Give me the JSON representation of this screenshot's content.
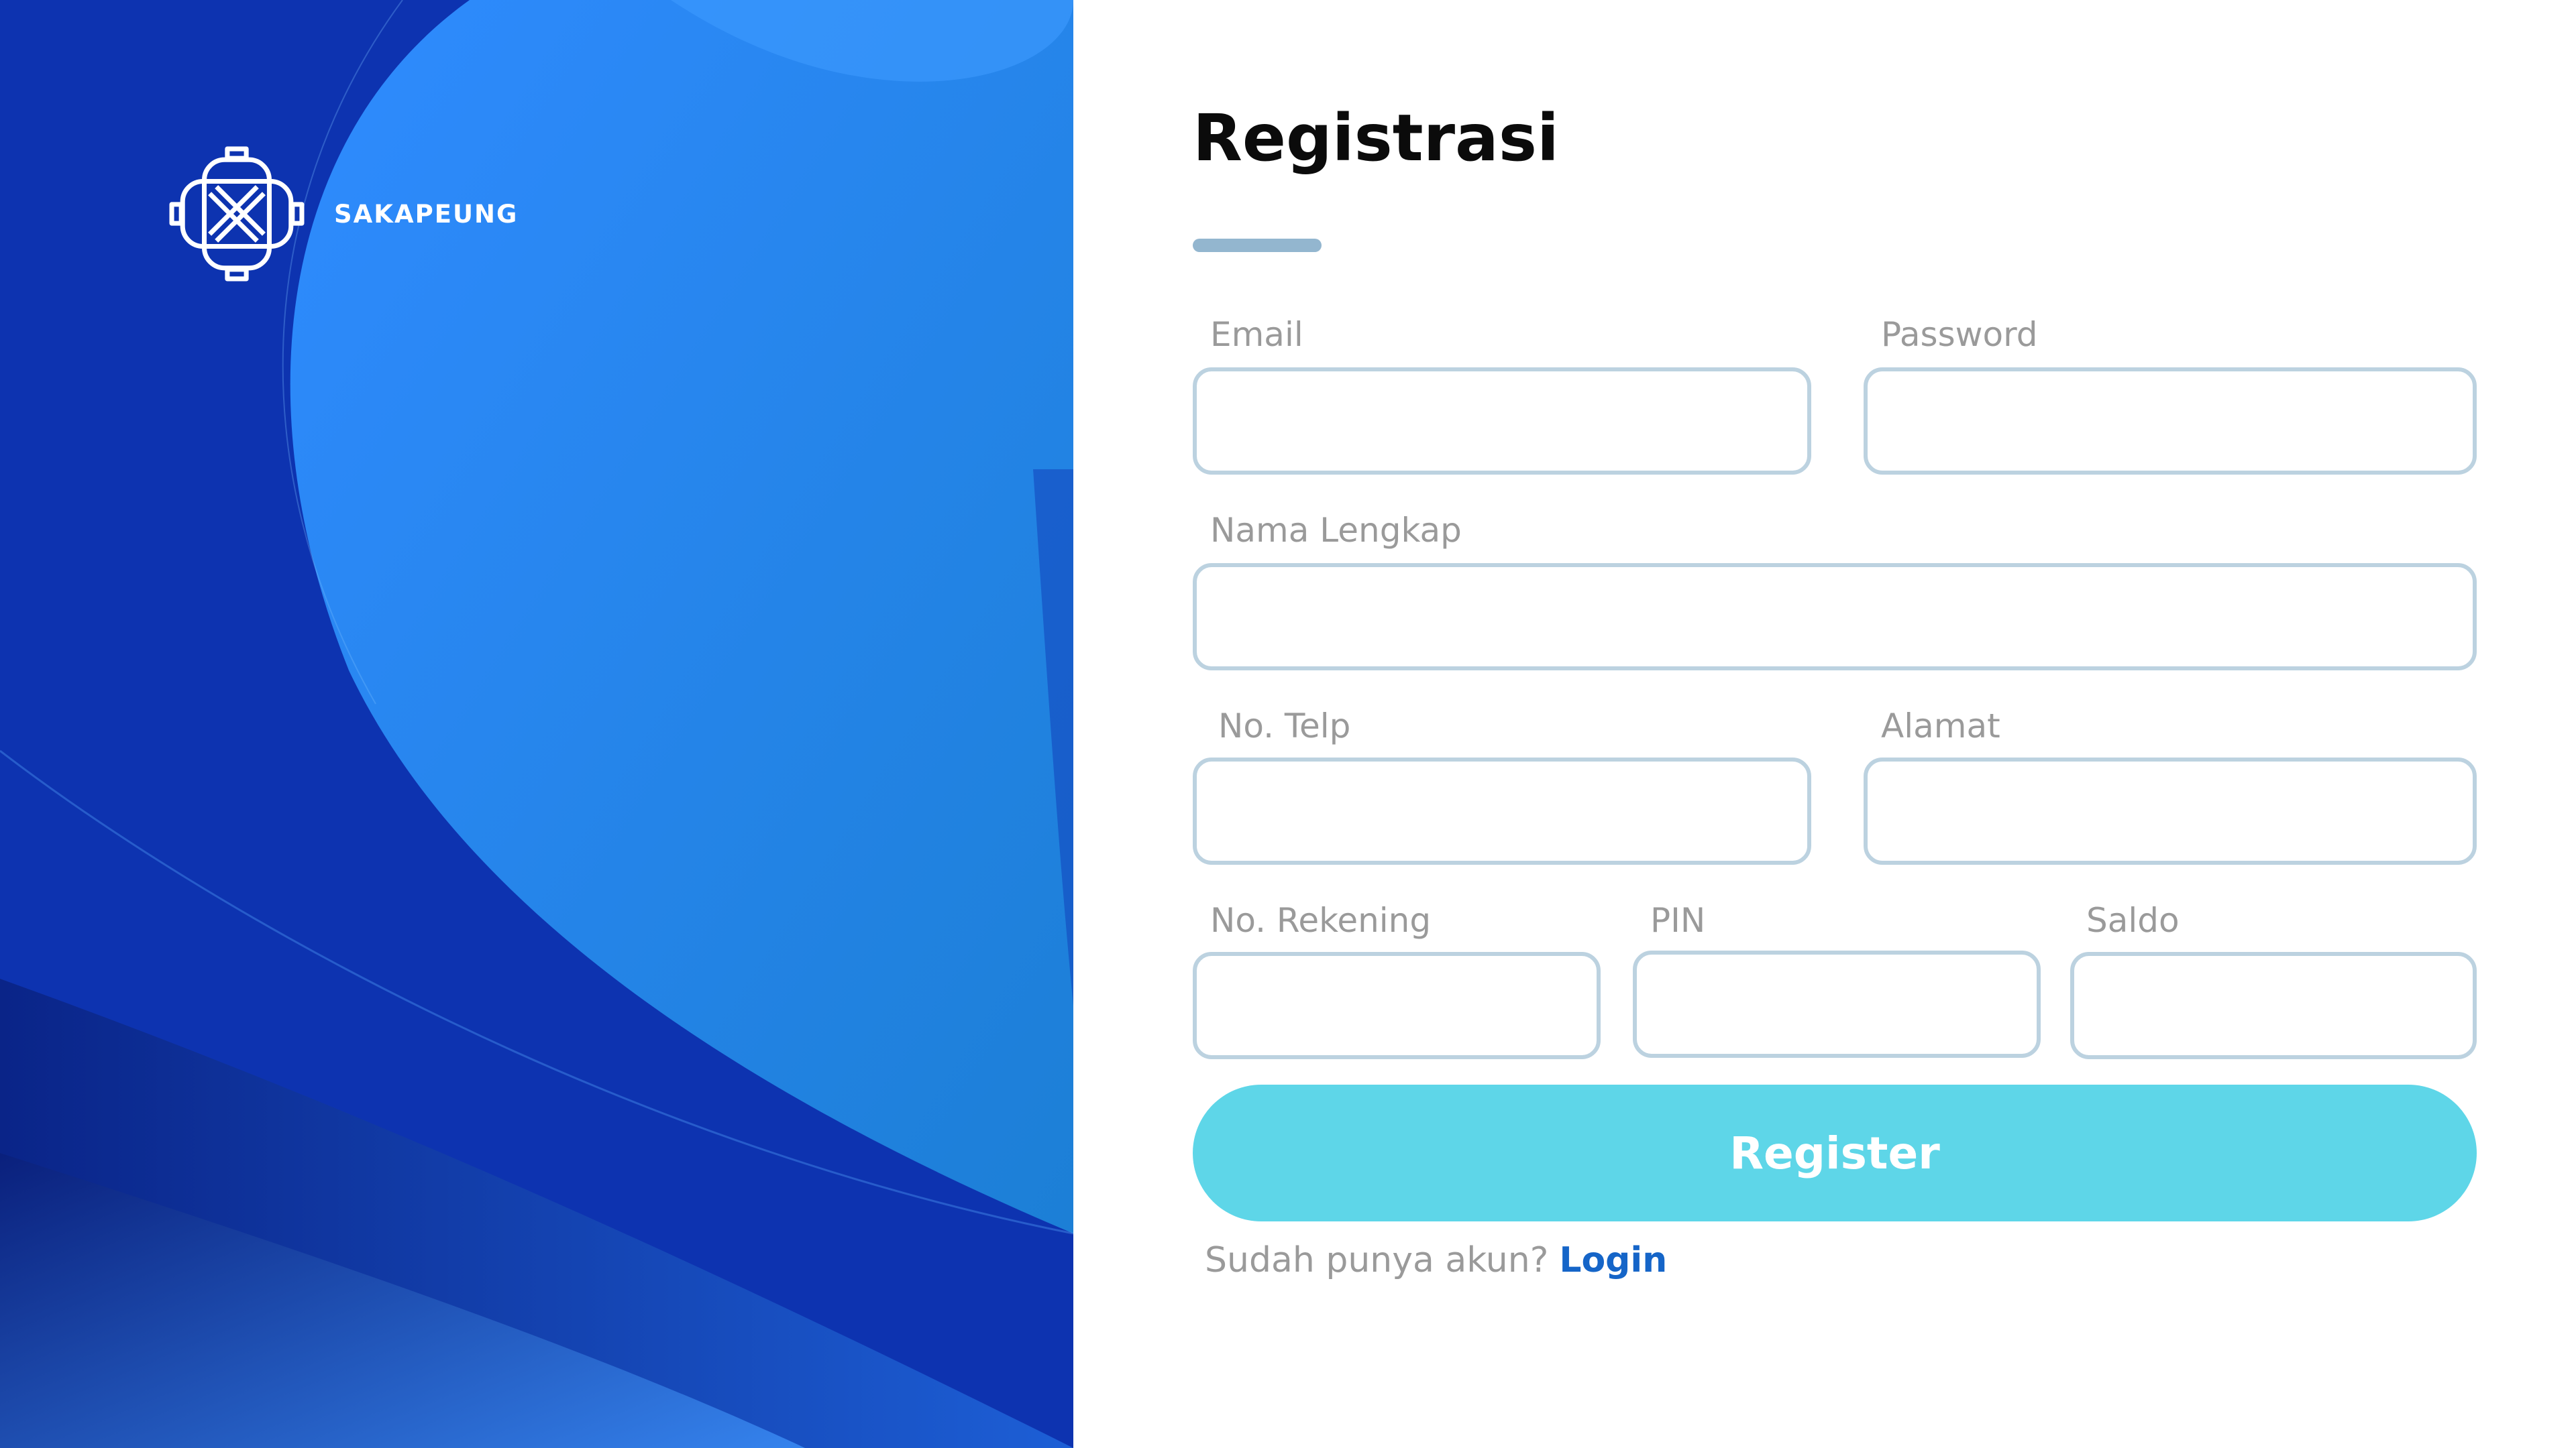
{
  "colors": {
    "hero_dark": "#0b2fa8",
    "hero_light": "#2a8cff",
    "field_border": "#bcd2e0",
    "title_bar": "#93b6cf",
    "button": "#5ed6e8",
    "link": "#1565c8",
    "label": "#9a9a9a"
  },
  "brand": {
    "name": "SAKAPEUNG",
    "logo_icon": "sakapeung-logo-icon"
  },
  "form": {
    "title": "Registrasi",
    "fields": {
      "email": {
        "label": "Email",
        "value": ""
      },
      "password": {
        "label": "Password",
        "value": ""
      },
      "nama_lengkap": {
        "label": "Nama Lengkap",
        "value": ""
      },
      "no_telp": {
        "label": "No. Telp",
        "value": ""
      },
      "alamat": {
        "label": "Alamat",
        "value": ""
      },
      "no_rekening": {
        "label": "No. Rekening",
        "value": ""
      },
      "pin": {
        "label": "PIN",
        "value": ""
      },
      "saldo": {
        "label": "Saldo",
        "value": ""
      }
    },
    "submit_label": "Register",
    "login_prompt": "Sudah punya akun?",
    "login_link": "Login"
  }
}
